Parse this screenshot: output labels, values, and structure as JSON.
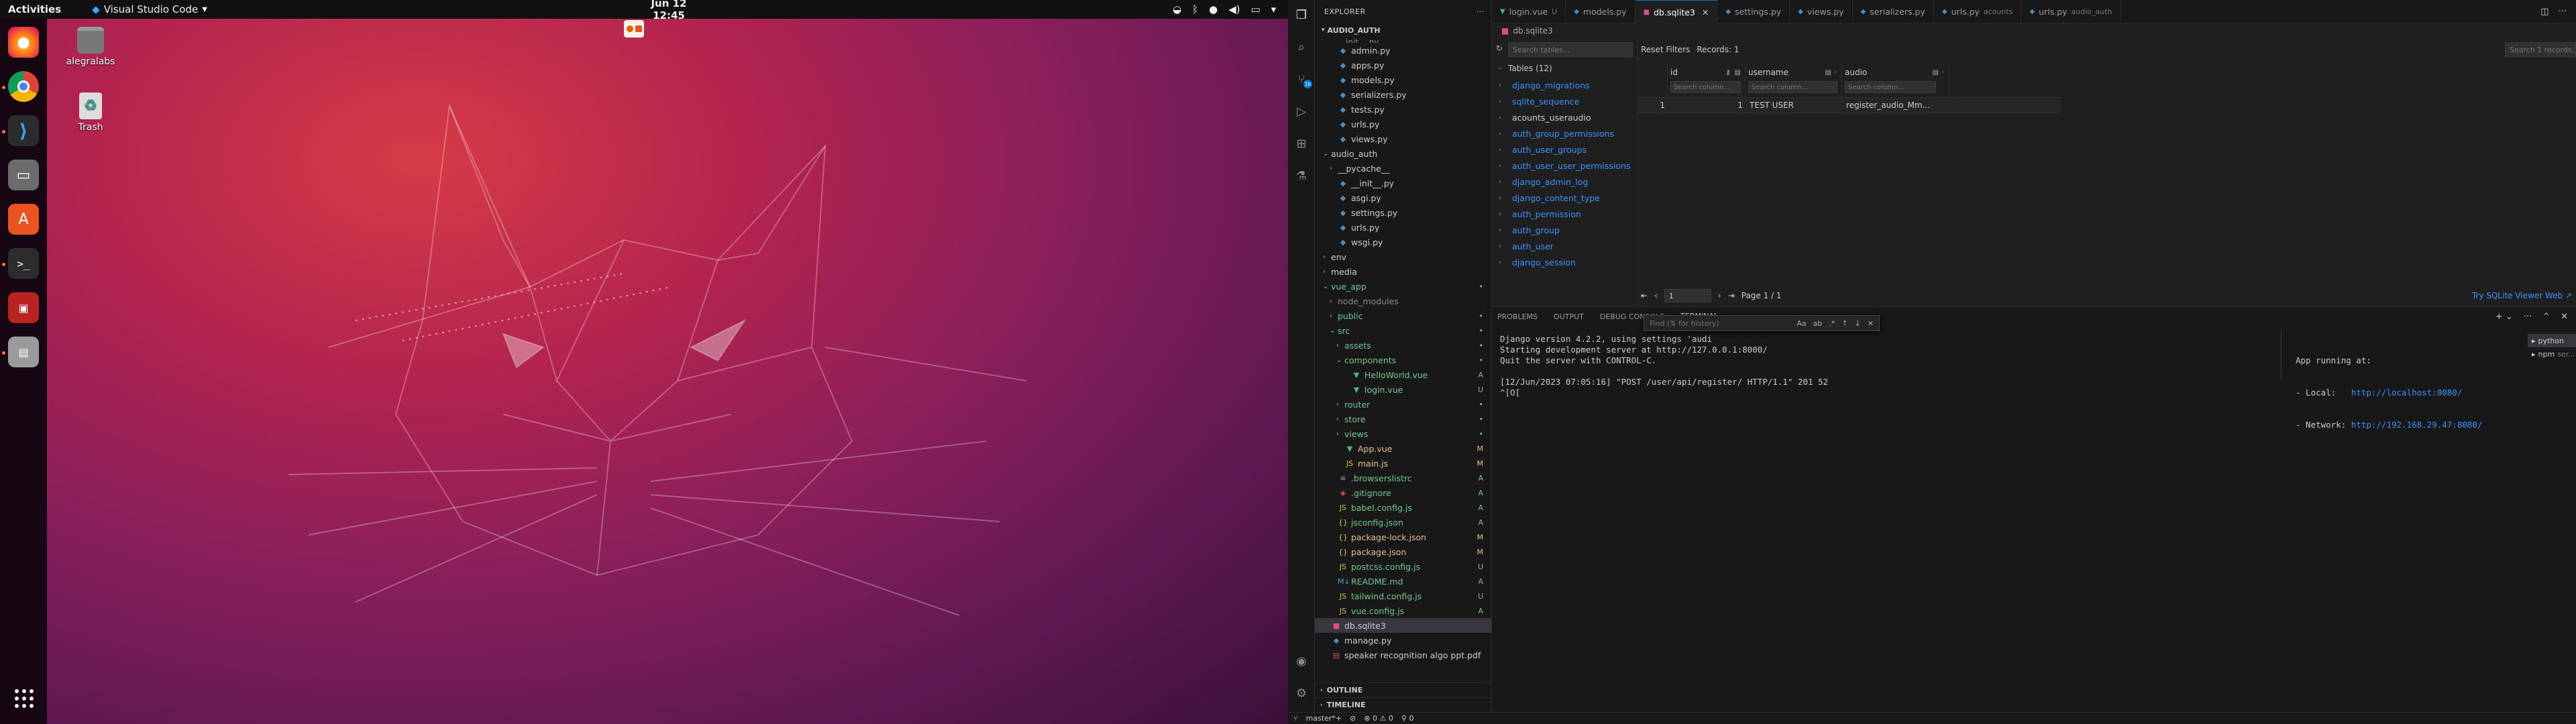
{
  "topbar": {
    "activities": "Activities",
    "app_name": "Visual Studio Code",
    "clock": "Jun 12  12:45"
  },
  "desktop": {
    "icons": [
      {
        "label": "alegralabs"
      },
      {
        "label": "Trash"
      }
    ]
  },
  "explorer": {
    "title": "EXPLORER",
    "root": "AUDIO_AUTH",
    "outline": "OUTLINE",
    "timeline": "TIMELINE",
    "rows": [
      {
        "label": "admin.py",
        "indent": 1,
        "icon": "py",
        "color": "#cccccc",
        "badge": ""
      },
      {
        "label": "apps.py",
        "indent": 1,
        "icon": "py",
        "color": "#cccccc",
        "badge": ""
      },
      {
        "label": "models.py",
        "indent": 1,
        "icon": "py",
        "color": "#cccccc",
        "badge": ""
      },
      {
        "label": "serializers.py",
        "indent": 1,
        "icon": "py",
        "color": "#cccccc",
        "badge": ""
      },
      {
        "label": "tests.py",
        "indent": 1,
        "icon": "py",
        "color": "#cccccc",
        "badge": ""
      },
      {
        "label": "urls.py",
        "indent": 1,
        "icon": "py",
        "color": "#cccccc",
        "badge": ""
      },
      {
        "label": "views.py",
        "indent": 1,
        "icon": "py",
        "color": "#cccccc",
        "badge": ""
      },
      {
        "label": "audio_auth",
        "indent": 0,
        "icon": "folder-open",
        "color": "#cccccc",
        "badge": ""
      },
      {
        "label": "__pycache__",
        "indent": 1,
        "icon": "folder",
        "color": "#cccccc",
        "badge": ""
      },
      {
        "label": "__init__.py",
        "indent": 1,
        "icon": "py",
        "color": "#cccccc",
        "badge": ""
      },
      {
        "label": "asgi.py",
        "indent": 1,
        "icon": "py",
        "color": "#cccccc",
        "badge": ""
      },
      {
        "label": "settings.py",
        "indent": 1,
        "icon": "py",
        "color": "#cccccc",
        "badge": ""
      },
      {
        "label": "urls.py",
        "indent": 1,
        "icon": "py",
        "color": "#cccccc",
        "badge": ""
      },
      {
        "label": "wsgi.py",
        "indent": 1,
        "icon": "py",
        "color": "#cccccc",
        "badge": ""
      },
      {
        "label": "env",
        "indent": 0,
        "icon": "folder",
        "color": "#cccccc",
        "badge": ""
      },
      {
        "label": "media",
        "indent": 0,
        "icon": "folder",
        "color": "#cccccc",
        "badge": ""
      },
      {
        "label": "vue_app",
        "indent": 0,
        "icon": "folder-open",
        "color": "#73c991",
        "badge": "•"
      },
      {
        "label": "node_modules",
        "indent": 1,
        "icon": "folder",
        "color": "#8c8c8c",
        "badge": ""
      },
      {
        "label": "public",
        "indent": 1,
        "icon": "folder",
        "color": "#73c991",
        "badge": "•"
      },
      {
        "label": "src",
        "indent": 1,
        "icon": "folder-open",
        "color": "#73c991",
        "badge": "•"
      },
      {
        "label": "assets",
        "indent": 2,
        "icon": "folder",
        "color": "#73c991",
        "badge": "•"
      },
      {
        "label": "components",
        "indent": 2,
        "icon": "folder-open",
        "color": "#73c991",
        "badge": "•"
      },
      {
        "label": "HelloWorld.vue",
        "indent": 3,
        "icon": "vue",
        "color": "#73c991",
        "badge": "A"
      },
      {
        "label": "login.vue",
        "indent": 3,
        "icon": "vue",
        "color": "#73c991",
        "badge": "U"
      },
      {
        "label": "router",
        "indent": 2,
        "icon": "folder",
        "color": "#73c991",
        "badge": "•"
      },
      {
        "label": "store",
        "indent": 2,
        "icon": "folder",
        "color": "#73c991",
        "badge": "•"
      },
      {
        "label": "views",
        "indent": 2,
        "icon": "folder",
        "color": "#73c991",
        "badge": "•"
      },
      {
        "label": "App.vue",
        "indent": 2,
        "icon": "vue",
        "color": "#e2c08d",
        "badge": "M"
      },
      {
        "label": "main.js",
        "indent": 2,
        "icon": "js",
        "color": "#e2c08d",
        "badge": "M"
      },
      {
        "label": ".browserslistrc",
        "indent": 1,
        "icon": "txt",
        "color": "#73c991",
        "badge": "A"
      },
      {
        "label": ".gitignore",
        "indent": 1,
        "icon": "git",
        "color": "#73c991",
        "badge": "A"
      },
      {
        "label": "babel.config.js",
        "indent": 1,
        "icon": "js",
        "color": "#73c991",
        "badge": "A"
      },
      {
        "label": "jsconfig.json",
        "indent": 1,
        "icon": "json",
        "color": "#73c991",
        "badge": "A"
      },
      {
        "label": "package-lock.json",
        "indent": 1,
        "icon": "json",
        "color": "#e2c08d",
        "badge": "M"
      },
      {
        "label": "package.json",
        "indent": 1,
        "icon": "json",
        "color": "#e2c08d",
        "badge": "M"
      },
      {
        "label": "postcss.config.js",
        "indent": 1,
        "icon": "js",
        "color": "#73c991",
        "badge": "U"
      },
      {
        "label": "README.md",
        "indent": 1,
        "icon": "md",
        "color": "#73c991",
        "badge": "A"
      },
      {
        "label": "tailwind.config.js",
        "indent": 1,
        "icon": "js",
        "color": "#73c991",
        "badge": "U"
      },
      {
        "label": "vue.config.js",
        "indent": 1,
        "icon": "js",
        "color": "#73c991",
        "badge": "A"
      },
      {
        "label": "db.sqlite3",
        "indent": 0,
        "icon": "db",
        "color": "#cccccc",
        "badge": "",
        "selected": true
      },
      {
        "label": "manage.py",
        "indent": 0,
        "icon": "py",
        "color": "#cccccc",
        "badge": ""
      },
      {
        "label": "speaker recognition algo ppt.pdf",
        "indent": 0,
        "icon": "pdf",
        "color": "#cccccc",
        "badge": ""
      }
    ]
  },
  "tabs": [
    {
      "label": "login.vue",
      "desc": "U",
      "icon": "vue",
      "active": false,
      "close": ""
    },
    {
      "label": "models.py",
      "desc": "",
      "icon": "py",
      "active": false,
      "close": ""
    },
    {
      "label": "db.sqlite3",
      "desc": "",
      "icon": "db",
      "active": true,
      "close": "✕"
    },
    {
      "label": "settings.py",
      "desc": "",
      "icon": "py",
      "active": false,
      "close": ""
    },
    {
      "label": "views.py",
      "desc": "",
      "icon": "py",
      "active": false,
      "close": ""
    },
    {
      "label": "serializers.py",
      "desc": "",
      "icon": "py",
      "active": false,
      "close": ""
    },
    {
      "label": "urls.py",
      "desc": "acounts",
      "icon": "py",
      "active": false,
      "close": ""
    },
    {
      "label": "urls.py",
      "desc": "audio_auth",
      "icon": "py",
      "active": false,
      "close": ""
    }
  ],
  "breadcrumb": "db.sqlite3",
  "sqlite": {
    "search_tables_placeholder": "Search tables...",
    "tables_header": "Tables (12)",
    "tables": [
      "django_migrations",
      "sqlite_sequence",
      "acounts_useraudio",
      "auth_group_permissions",
      "auth_user_groups",
      "auth_user_user_permissions",
      "django_admin_log",
      "django_content_type",
      "auth_permission",
      "auth_group",
      "auth_user",
      "django_session"
    ],
    "current_table": "acounts_useraudio",
    "reset_filters": "Reset Filters",
    "records": "Records: 1",
    "search_records_placeholder": "Search 1 records...",
    "columns": [
      {
        "name": "id",
        "placeholder": "Search column..."
      },
      {
        "name": "username",
        "placeholder": "Search column..."
      },
      {
        "name": "audio",
        "placeholder": "Search column..."
      }
    ],
    "rows": [
      {
        "rownum": "1",
        "id": "1",
        "username": "TEST USER",
        "audio": "register_audio_Mm..."
      }
    ],
    "page_value": "1",
    "page_label": "Page 1 / 1",
    "try_link": "Try SQLite Viewer Web ↗"
  },
  "panel": {
    "tabs": [
      "PROBLEMS",
      "OUTPUT",
      "DEBUG CONSOLE",
      "TERMINAL"
    ],
    "find_placeholder": "Find (⇅ for history)",
    "find_opts": [
      "Aa",
      "ab",
      ".*"
    ],
    "term_left": {
      "l1": "Django version 4.2.2, using settings 'audi",
      "l2": "Starting development server at http://127.0.0.1:8000/",
      "l3": "Quit the server with CONTROL-C.",
      "l4": "",
      "l5": "[12/Jun/2023 07:05:16] \"POST /user/api/register/ HTTP/1.1\" 201 52",
      "l6": "^[O["
    },
    "term_right": {
      "l1": "App running at:",
      "local_label": "- Local:   ",
      "local_url": "http://localhost:8080/",
      "network_label": "- Network: ",
      "network_url": "http://192.168.29.47:8080/"
    },
    "terminals": [
      {
        "label": "python",
        "active": true
      },
      {
        "label": "npm",
        "desc": "ser...",
        "active": false
      }
    ]
  },
  "statusbar": {
    "branch": "master*+",
    "sync": "⊘",
    "problems": "⊗ 0 ⚠ 0",
    "ports": "⚲ 0"
  }
}
